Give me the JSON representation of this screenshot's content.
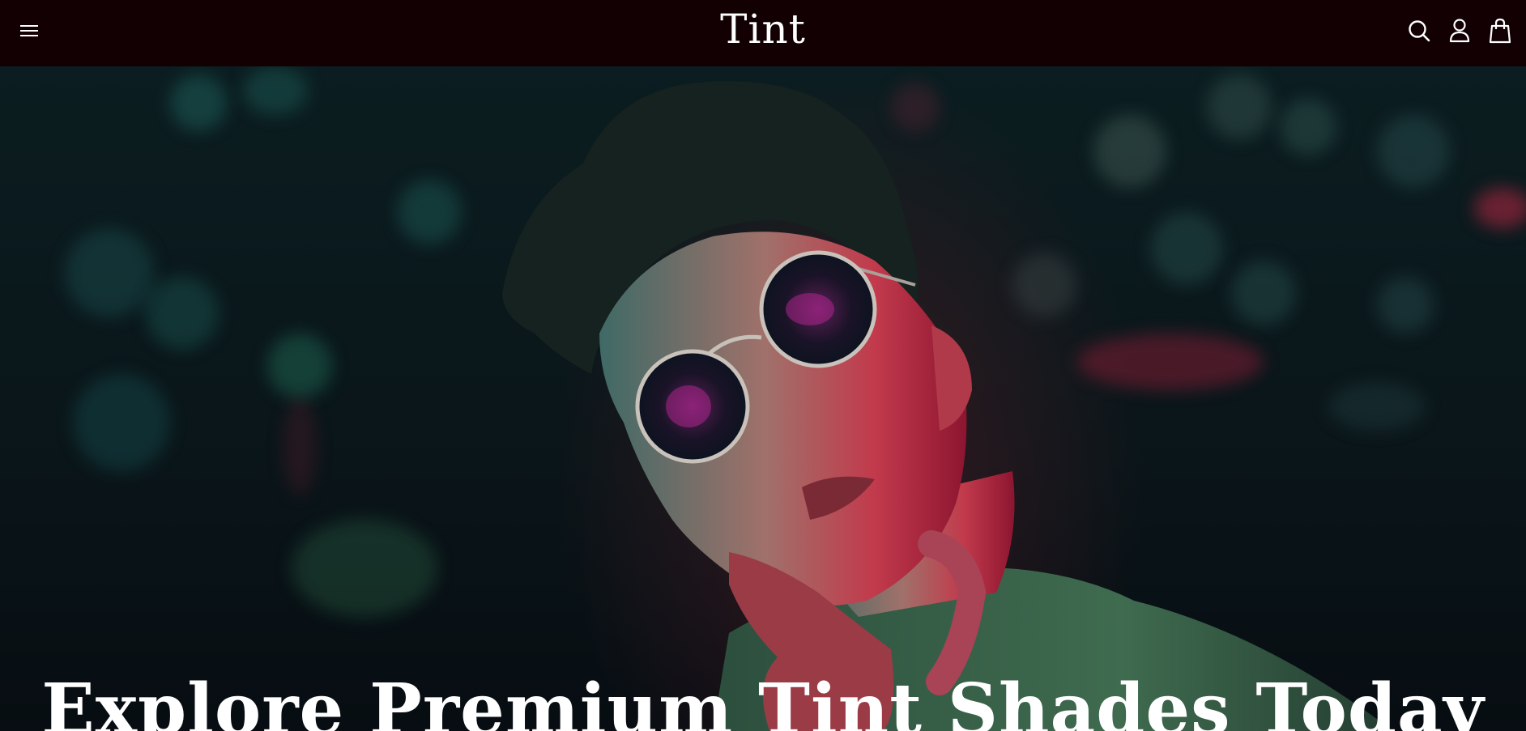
{
  "header": {
    "logo": "Tint",
    "menu_icon": "hamburger-menu-icon",
    "icons": [
      "search-icon",
      "account-icon",
      "cart-bag-icon"
    ],
    "background_color": "#120003"
  },
  "hero": {
    "heading": "Explore Premium Tint Shades Today",
    "image": "man-wearing-round-sunglasses-neon-bokeh-background"
  }
}
